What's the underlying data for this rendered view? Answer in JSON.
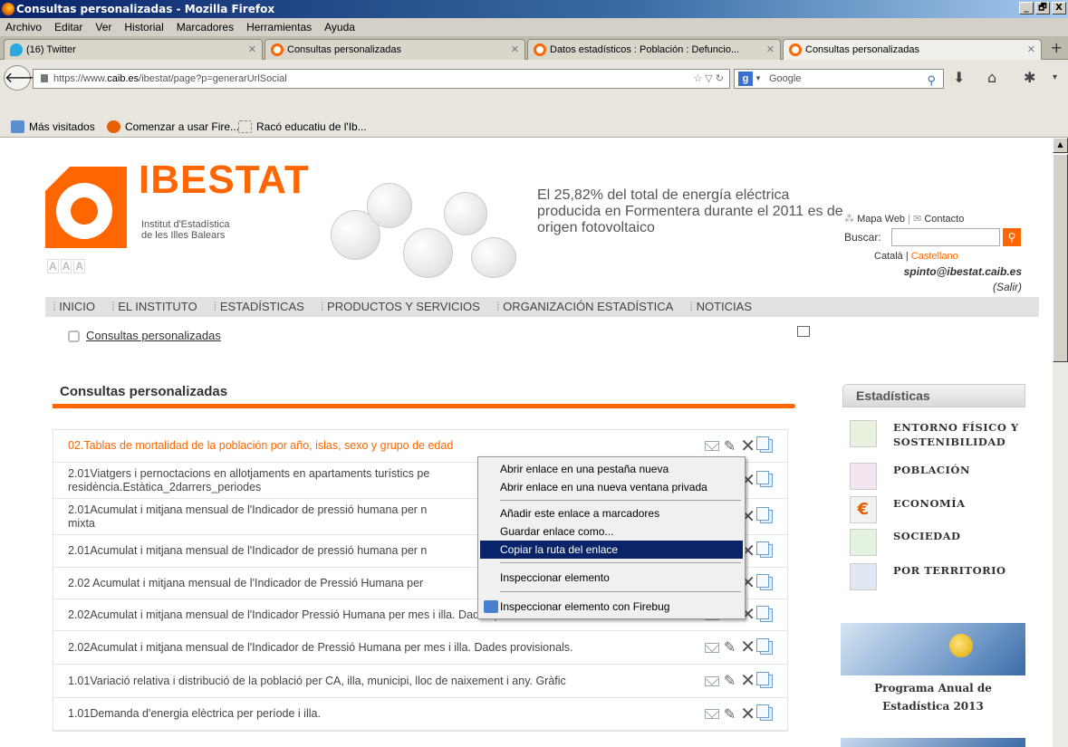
{
  "window": {
    "title": "Consultas personalizadas - Mozilla Firefox",
    "buttons": [
      "_",
      "🗗",
      "X"
    ]
  },
  "menubar": [
    "Archivo",
    "Editar",
    "Ver",
    "Historial",
    "Marcadores",
    "Herramientas",
    "Ayuda"
  ],
  "tabs": [
    {
      "label": "(16) Twitter",
      "icon": "twitter-icon"
    },
    {
      "label": "Consultas personalizadas",
      "icon": "ibestat-icon"
    },
    {
      "label": "Datos estadísticos : Población : Defuncio...",
      "icon": "ibestat-icon"
    },
    {
      "label": "Consultas personalizadas",
      "icon": "ibestat-icon",
      "active": true
    }
  ],
  "nav": {
    "url_prefix": "https://www.",
    "url_domain": "caib.es",
    "url_suffix": "/ibestat/page?p=generarUrlSocial",
    "search_engine": "Google"
  },
  "bookmarks": [
    "Más visitados",
    "Comenzar a usar Fire...",
    "Racó educatiu de l'Ib..."
  ],
  "site": {
    "logo_title": "IBESTAT",
    "logo_sub": "Institut d'Estadística\nde les Illes Balears",
    "font_sizes": [
      "A",
      "A",
      "A"
    ],
    "headline": "El 25,82% del total de energía eléctrica producida en Formentera durante el 2011 es de origen fotovoltaico",
    "mapa_web": "Mapa Web",
    "contacto": "Contacto",
    "buscar": "Buscar:",
    "lang_ca": "Català",
    "lang_es": "Castellano",
    "user": "spinto@ibestat.caib.es",
    "salir": "(Salir)",
    "nav_items": [
      "INICIO",
      "EL INSTITUTO",
      "ESTADÍSTICAS",
      "PRODUCTOS Y SERVICIOS",
      "ORGANIZACIÓN ESTADÍSTICA",
      "NOTICIAS"
    ],
    "breadcrumb": "Consultas personalizadas",
    "section_title": "Consultas personalizadas",
    "queries": [
      "02.Tablas de mortalidad de la población por año, islas, sexo y grupo de edad",
      "2.01Viatgers i pernoctacions en allotjaments en apartaments turístics pe\nresidència.Estàtica_2darrers_periodes",
      "2.01Acumulat i mitjana mensual de l'Indicador de pressió humana per n\nmixta",
      "2.01Acumulat i mitjana mensual de l'Indicador de pressió humana per n",
      "2.02 Acumulat i mitjana mensual de l'Indicador de Pressió Humana per",
      "2.02Acumulat i mitjana mensual de l'Indicador Pressió Humana per mes i illa. Dades provisionals. Gràfic",
      "2.02Acumulat i mitjana mensual de l'Indicador de Pressió Humana per mes i illa. Dades provisionals.",
      "1.01Variació relativa i distribució de la població per CA, illa, municipi, lloc de naixement i any. Gràfic",
      "1.01Demanda d'energia elèctrica per període i illa."
    ],
    "sidebar_title": "Estadísticas",
    "sidebar_items": [
      "ENTORNO FÍSICO Y SOSTENIBILIDAD",
      "POBLACIÓN",
      "ECONOMÍA",
      "SOCIEDAD",
      "POR TERRITORIO"
    ],
    "sidebar_icons": [
      "leaf-icon",
      "people-icon",
      "euro-icon",
      "society-icon",
      "map-icon"
    ],
    "sidebar_caption": "Programa Anual de Estadística 2013"
  },
  "context_menu": [
    "Abrir enlace en una pestaña nueva",
    "Abrir enlace en una nueva ventana privada",
    "Añadir este enlace a marcadores",
    "Guardar enlace como...",
    "Copiar la ruta del enlace",
    "Inspeccionar elemento",
    "Inspeccionar elemento con Firebug"
  ],
  "colors": {
    "accent": "#ff6600",
    "highlight": "#0a246a"
  }
}
